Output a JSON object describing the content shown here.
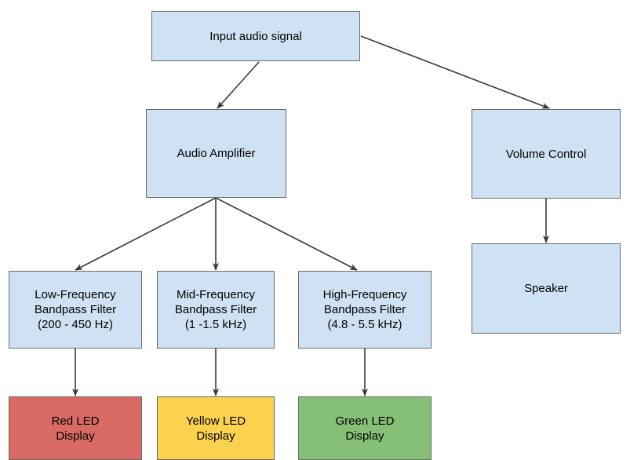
{
  "diagram": {
    "title": "Audio signal processing block diagram",
    "background_color": "#ffffff",
    "edge_color": "#3a3a3a",
    "node_border_color": "#6b6b6b",
    "colors": {
      "blue": "#cfe2f3",
      "red": "#d96a64",
      "yellow": "#fad24e",
      "green": "#86bf76"
    },
    "nodes": {
      "input_audio_signal": "Input audio signal",
      "audio_amplifier": "Audio Amplifier",
      "volume_control": "Volume Control",
      "speaker": "Speaker",
      "low_freq_filter": "Low-Frequency\nBandpass Filter\n(200 - 450 Hz)",
      "mid_freq_filter": "Mid-Frequency\nBandpass Filter\n(1 -1.5 kHz)",
      "high_freq_filter": "High-Frequency\nBandpass Filter\n(4.8 - 5.5 kHz)",
      "red_led_display": "Red LED\nDisplay",
      "yellow_led_display": "Yellow LED\nDisplay",
      "green_led_display": "Green LED\nDisplay"
    },
    "edges": [
      {
        "name": "input-to-amplifier",
        "from": "input_audio_signal",
        "to": "audio_amplifier"
      },
      {
        "name": "input-to-volume-control",
        "from": "input_audio_signal",
        "to": "volume_control"
      },
      {
        "name": "volume-to-speaker",
        "from": "volume_control",
        "to": "speaker"
      },
      {
        "name": "amplifier-to-low-filter",
        "from": "audio_amplifier",
        "to": "low_freq_filter"
      },
      {
        "name": "amplifier-to-mid-filter",
        "from": "audio_amplifier",
        "to": "mid_freq_filter"
      },
      {
        "name": "amplifier-to-high-filter",
        "from": "audio_amplifier",
        "to": "high_freq_filter"
      },
      {
        "name": "low-filter-to-red-led",
        "from": "low_freq_filter",
        "to": "red_led_display"
      },
      {
        "name": "mid-filter-to-yellow-led",
        "from": "mid_freq_filter",
        "to": "yellow_led_display"
      },
      {
        "name": "high-filter-to-green-led",
        "from": "high_freq_filter",
        "to": "green_led_display"
      }
    ]
  }
}
